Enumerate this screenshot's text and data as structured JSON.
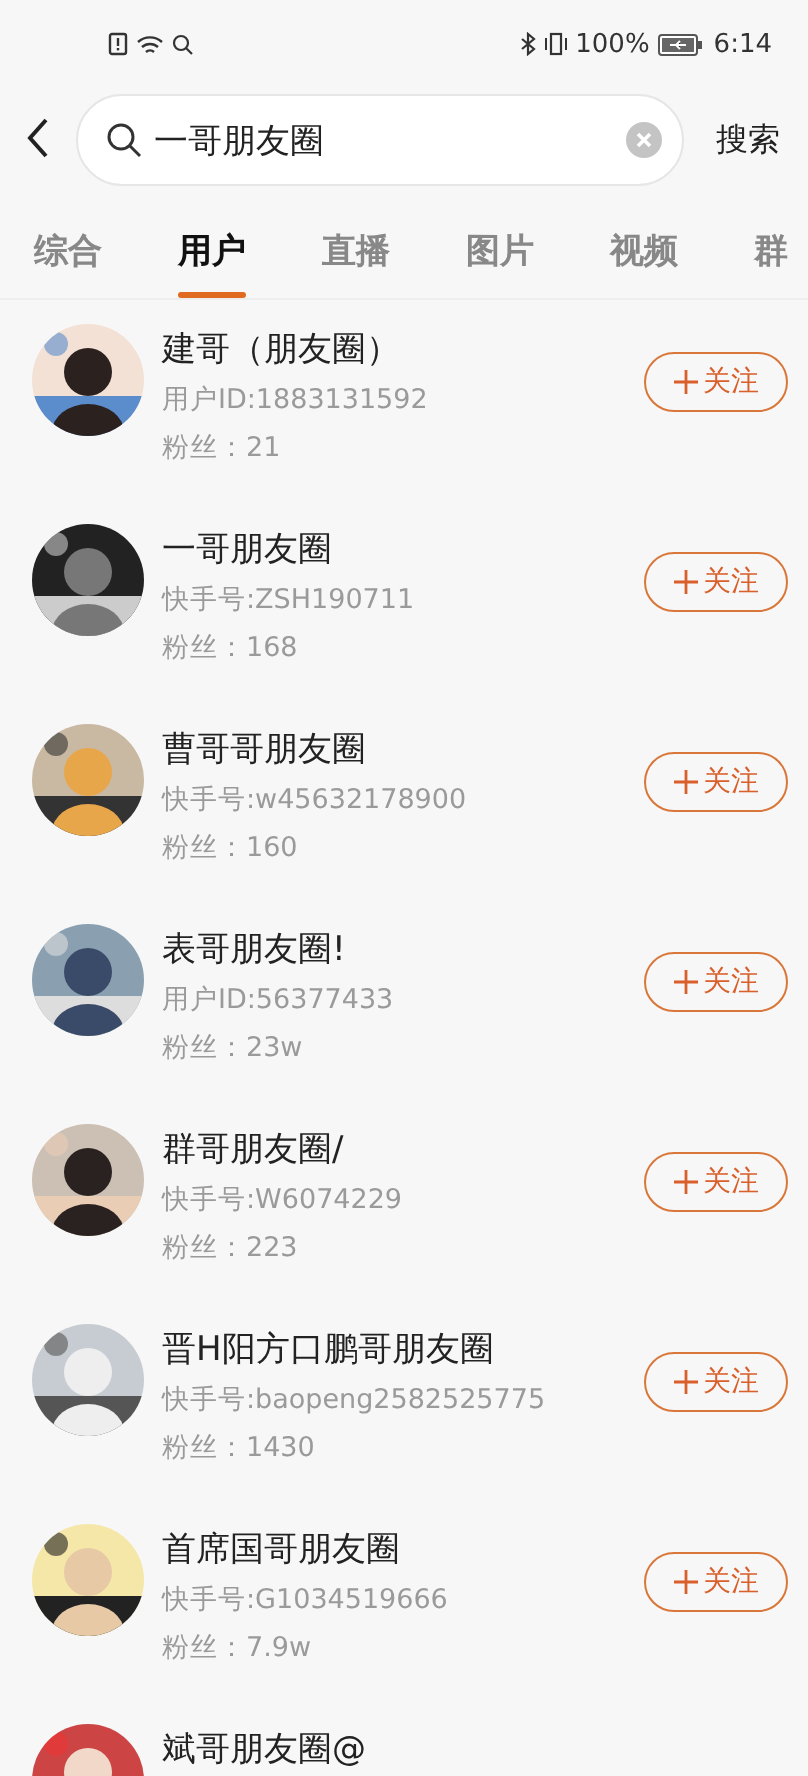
{
  "status_bar": {
    "battery_percent": "100%",
    "time": "6:14"
  },
  "search": {
    "value": "一哥朋友圈",
    "button": "搜索"
  },
  "tabs": [
    {
      "label": "综合",
      "selected": false
    },
    {
      "label": "用户",
      "selected": true
    },
    {
      "label": "直播",
      "selected": false
    },
    {
      "label": "图片",
      "selected": false
    },
    {
      "label": "视频",
      "selected": false
    },
    {
      "label": "群",
      "selected": false
    }
  ],
  "users": [
    {
      "name": "建哥（朋友圈）",
      "account": "用户ID:1883131592",
      "fans": "粉丝：21",
      "follow": "关注"
    },
    {
      "name": "一哥朋友圈",
      "account": "快手号:ZSH190711",
      "fans": "粉丝：168",
      "follow": "关注"
    },
    {
      "name": "曹哥哥朋友圈",
      "account": "快手号:w45632178900",
      "fans": "粉丝：160",
      "follow": "关注"
    },
    {
      "name": "表哥朋友圈!",
      "account": "用户ID:56377433",
      "fans": "粉丝：23w",
      "follow": "关注"
    },
    {
      "name": "群哥朋友圈/",
      "account": "快手号:W6074229",
      "fans": "粉丝：223",
      "follow": "关注"
    },
    {
      "name": "晋H阳方口鹏哥朋友圈",
      "account": "快手号:baopeng2582525775",
      "fans": "粉丝：1430",
      "follow": "关注"
    },
    {
      "name": "首席国哥朋友圈",
      "account": "快手号:G1034519666",
      "fans": "粉丝：7.9w",
      "follow": "关注"
    },
    {
      "name": "斌哥朋友圈@"
    }
  ]
}
